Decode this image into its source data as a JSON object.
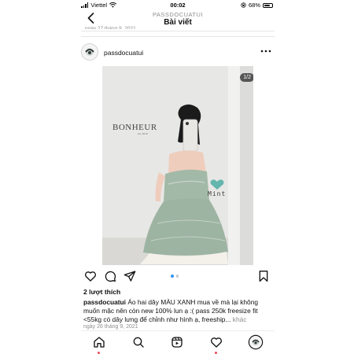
{
  "status_bar": {
    "carrier": "Viettel",
    "time": "00:02",
    "battery": "68%",
    "icons": [
      "signal-icon",
      "wifi-icon",
      "lock-rotation-icon",
      "battery-icon"
    ]
  },
  "header": {
    "account": "PASSDOCUATUI",
    "title": "Bài viết",
    "prev_date": "ngày 27 tháng 9, 2021",
    "back_icon": "chevron-left-icon"
  },
  "post": {
    "username": "passdocuatui",
    "more_icon": "ellipsis-icon",
    "image_counter": "1/2",
    "image": {
      "brand": "BONHEUR",
      "brand_sub": "est. 2019",
      "sticker_text": "Mint",
      "colors": {
        "dress": "#9fb7a4",
        "wall": "#e7e7e5",
        "heart": "#63b6ad"
      }
    },
    "carousel": {
      "count": 2,
      "active": 1,
      "active_color": "#3897f0"
    },
    "likes": "2 lượt thích",
    "caption_text": "Áo hai dây MÀU XANH mua về mà lại không muốn mặc nên còn new 100% lun ạ :( pass 250k freesize fit <55kg có dây lưng để chỉnh như hình ạ, freeship...",
    "caption_more": "khác",
    "date": "ngày 26 tháng 9, 2021"
  },
  "actions": [
    "heart-icon",
    "comment-icon",
    "share-icon",
    "bookmark-icon"
  ],
  "bottom_nav": [
    "home-icon",
    "search-icon",
    "reels-icon",
    "activity-icon",
    "profile-avatar"
  ],
  "colors": {
    "notification_dot": "#ed4956",
    "secondary_text": "#8e8e8e"
  }
}
